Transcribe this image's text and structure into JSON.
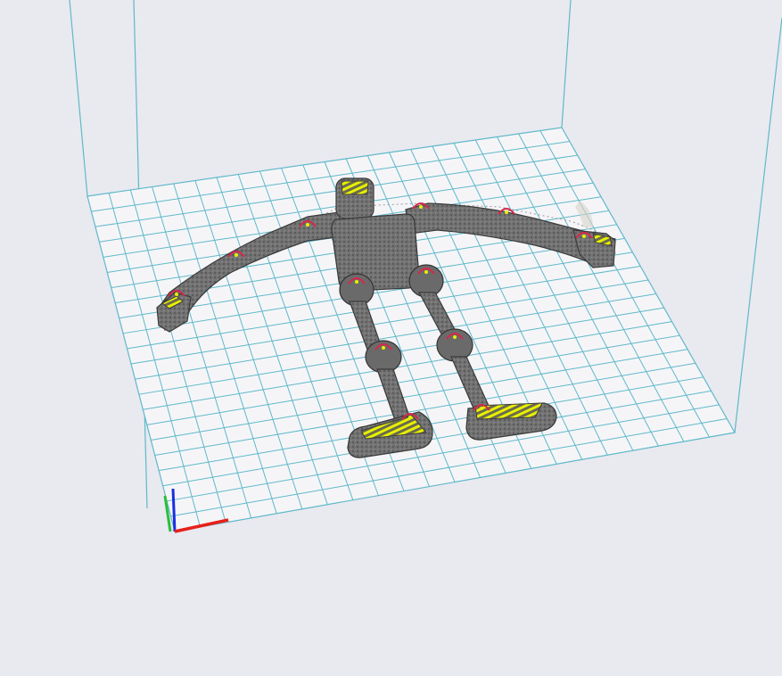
{
  "viewer": {
    "background": "#e9e9f0",
    "bed_line_color": "#5fb9c9",
    "model_color": "#6e6e6e",
    "perimeter_color": "#d6284a",
    "top_layer_color": "#e8f000",
    "axis_colors": {
      "x": "#e8201a",
      "y": "#2bbf3a",
      "z": "#1a2fe0"
    }
  },
  "model": {
    "description_icon": "sliced-robot-figure-icon"
  }
}
